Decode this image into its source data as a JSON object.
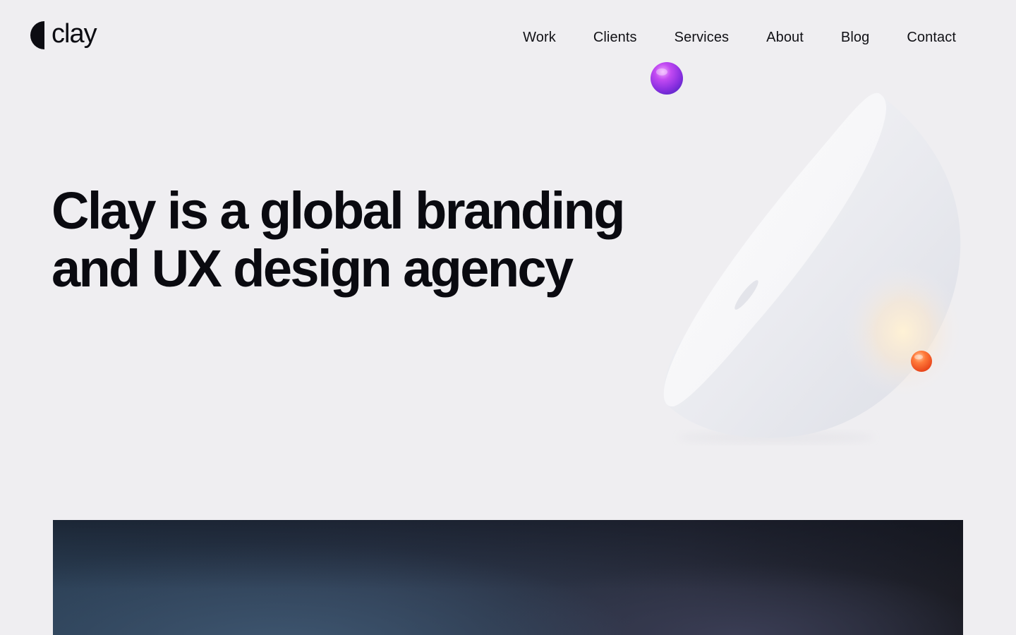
{
  "brand": {
    "name": "clay"
  },
  "nav": {
    "items": [
      {
        "label": "Work"
      },
      {
        "label": "Clients"
      },
      {
        "label": "Services"
      },
      {
        "label": "About"
      },
      {
        "label": "Blog"
      },
      {
        "label": "Contact"
      }
    ]
  },
  "hero": {
    "title_line_1": "Clay is a global branding",
    "title_line_2": "and UX design agency"
  },
  "illustration": {
    "bowl_color": "#f7f7f9",
    "purple_sphere_color": "#b53df0",
    "orange_sphere_color": "#ff5a1f"
  },
  "colors": {
    "background": "#efeef1",
    "text": "#0c0c12",
    "showreel_dark": "#1b1c24"
  }
}
